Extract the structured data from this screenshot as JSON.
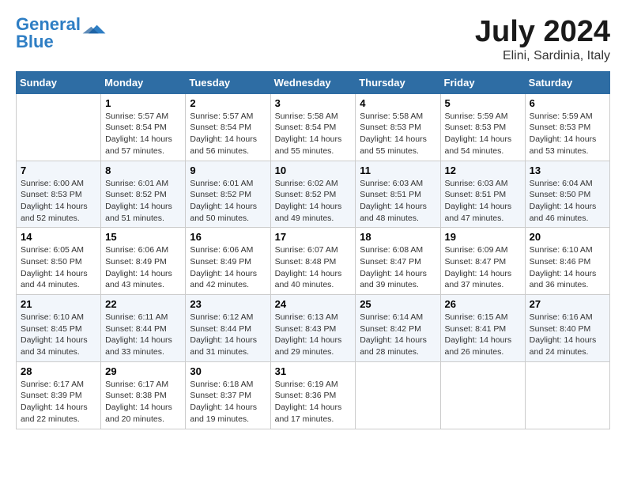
{
  "logo": {
    "line1": "General",
    "line2": "Blue"
  },
  "title": "July 2024",
  "location": "Elini, Sardinia, Italy",
  "weekdays": [
    "Sunday",
    "Monday",
    "Tuesday",
    "Wednesday",
    "Thursday",
    "Friday",
    "Saturday"
  ],
  "weeks": [
    [
      {
        "day": "",
        "info": ""
      },
      {
        "day": "1",
        "info": "Sunrise: 5:57 AM\nSunset: 8:54 PM\nDaylight: 14 hours\nand 57 minutes."
      },
      {
        "day": "2",
        "info": "Sunrise: 5:57 AM\nSunset: 8:54 PM\nDaylight: 14 hours\nand 56 minutes."
      },
      {
        "day": "3",
        "info": "Sunrise: 5:58 AM\nSunset: 8:54 PM\nDaylight: 14 hours\nand 55 minutes."
      },
      {
        "day": "4",
        "info": "Sunrise: 5:58 AM\nSunset: 8:53 PM\nDaylight: 14 hours\nand 55 minutes."
      },
      {
        "day": "5",
        "info": "Sunrise: 5:59 AM\nSunset: 8:53 PM\nDaylight: 14 hours\nand 54 minutes."
      },
      {
        "day": "6",
        "info": "Sunrise: 5:59 AM\nSunset: 8:53 PM\nDaylight: 14 hours\nand 53 minutes."
      }
    ],
    [
      {
        "day": "7",
        "info": "Sunrise: 6:00 AM\nSunset: 8:53 PM\nDaylight: 14 hours\nand 52 minutes."
      },
      {
        "day": "8",
        "info": "Sunrise: 6:01 AM\nSunset: 8:52 PM\nDaylight: 14 hours\nand 51 minutes."
      },
      {
        "day": "9",
        "info": "Sunrise: 6:01 AM\nSunset: 8:52 PM\nDaylight: 14 hours\nand 50 minutes."
      },
      {
        "day": "10",
        "info": "Sunrise: 6:02 AM\nSunset: 8:52 PM\nDaylight: 14 hours\nand 49 minutes."
      },
      {
        "day": "11",
        "info": "Sunrise: 6:03 AM\nSunset: 8:51 PM\nDaylight: 14 hours\nand 48 minutes."
      },
      {
        "day": "12",
        "info": "Sunrise: 6:03 AM\nSunset: 8:51 PM\nDaylight: 14 hours\nand 47 minutes."
      },
      {
        "day": "13",
        "info": "Sunrise: 6:04 AM\nSunset: 8:50 PM\nDaylight: 14 hours\nand 46 minutes."
      }
    ],
    [
      {
        "day": "14",
        "info": "Sunrise: 6:05 AM\nSunset: 8:50 PM\nDaylight: 14 hours\nand 44 minutes."
      },
      {
        "day": "15",
        "info": "Sunrise: 6:06 AM\nSunset: 8:49 PM\nDaylight: 14 hours\nand 43 minutes."
      },
      {
        "day": "16",
        "info": "Sunrise: 6:06 AM\nSunset: 8:49 PM\nDaylight: 14 hours\nand 42 minutes."
      },
      {
        "day": "17",
        "info": "Sunrise: 6:07 AM\nSunset: 8:48 PM\nDaylight: 14 hours\nand 40 minutes."
      },
      {
        "day": "18",
        "info": "Sunrise: 6:08 AM\nSunset: 8:47 PM\nDaylight: 14 hours\nand 39 minutes."
      },
      {
        "day": "19",
        "info": "Sunrise: 6:09 AM\nSunset: 8:47 PM\nDaylight: 14 hours\nand 37 minutes."
      },
      {
        "day": "20",
        "info": "Sunrise: 6:10 AM\nSunset: 8:46 PM\nDaylight: 14 hours\nand 36 minutes."
      }
    ],
    [
      {
        "day": "21",
        "info": "Sunrise: 6:10 AM\nSunset: 8:45 PM\nDaylight: 14 hours\nand 34 minutes."
      },
      {
        "day": "22",
        "info": "Sunrise: 6:11 AM\nSunset: 8:44 PM\nDaylight: 14 hours\nand 33 minutes."
      },
      {
        "day": "23",
        "info": "Sunrise: 6:12 AM\nSunset: 8:44 PM\nDaylight: 14 hours\nand 31 minutes."
      },
      {
        "day": "24",
        "info": "Sunrise: 6:13 AM\nSunset: 8:43 PM\nDaylight: 14 hours\nand 29 minutes."
      },
      {
        "day": "25",
        "info": "Sunrise: 6:14 AM\nSunset: 8:42 PM\nDaylight: 14 hours\nand 28 minutes."
      },
      {
        "day": "26",
        "info": "Sunrise: 6:15 AM\nSunset: 8:41 PM\nDaylight: 14 hours\nand 26 minutes."
      },
      {
        "day": "27",
        "info": "Sunrise: 6:16 AM\nSunset: 8:40 PM\nDaylight: 14 hours\nand 24 minutes."
      }
    ],
    [
      {
        "day": "28",
        "info": "Sunrise: 6:17 AM\nSunset: 8:39 PM\nDaylight: 14 hours\nand 22 minutes."
      },
      {
        "day": "29",
        "info": "Sunrise: 6:17 AM\nSunset: 8:38 PM\nDaylight: 14 hours\nand 20 minutes."
      },
      {
        "day": "30",
        "info": "Sunrise: 6:18 AM\nSunset: 8:37 PM\nDaylight: 14 hours\nand 19 minutes."
      },
      {
        "day": "31",
        "info": "Sunrise: 6:19 AM\nSunset: 8:36 PM\nDaylight: 14 hours\nand 17 minutes."
      },
      {
        "day": "",
        "info": ""
      },
      {
        "day": "",
        "info": ""
      },
      {
        "day": "",
        "info": ""
      }
    ]
  ]
}
